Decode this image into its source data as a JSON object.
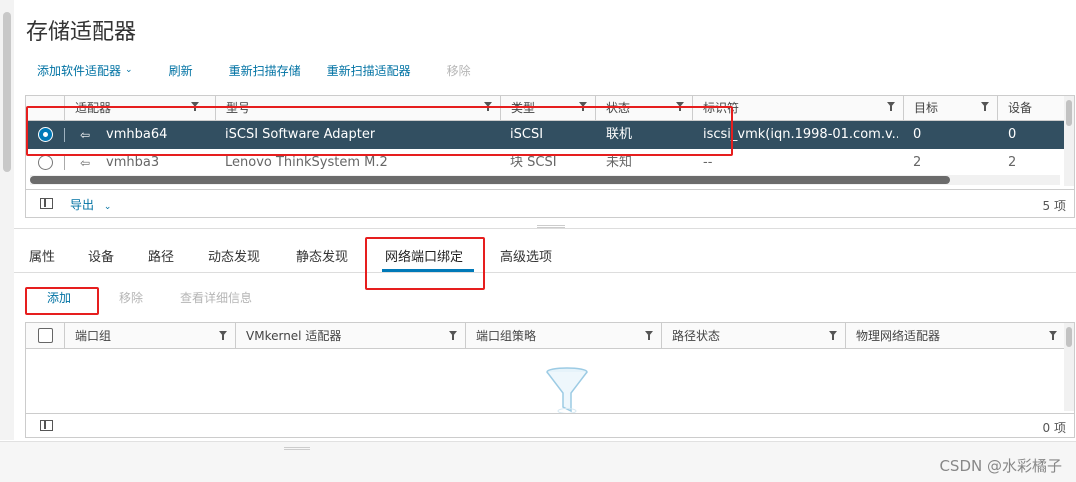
{
  "page": {
    "title": "存储适配器"
  },
  "toolbar": {
    "add_software_adapter": "添加软件适配器",
    "refresh": "刷新",
    "rescan_storage": "重新扫描存储",
    "rescan_adapter": "重新扫描适配器",
    "remove": "移除"
  },
  "adapters_grid": {
    "columns": [
      "适配器",
      "型号",
      "类型",
      "状态",
      "标识符",
      "目标",
      "设备"
    ],
    "rows": [
      {
        "selected": true,
        "adapter": "vmhba64",
        "model": "iSCSI Software Adapter",
        "type": "iSCSI",
        "status": "联机",
        "identifier": "iscsi_vmk(iqn.1998-01.com.v...",
        "targets": "0",
        "devices": "0"
      },
      {
        "selected": false,
        "adapter": "vmhba3",
        "model": "Lenovo ThinkSystem M.2",
        "type": "块 SCSI",
        "status": "未知",
        "identifier": "--",
        "targets": "2",
        "devices": "2"
      }
    ],
    "footer": {
      "export": "导出",
      "count": "5 项"
    }
  },
  "tabs": [
    "属性",
    "设备",
    "路径",
    "动态发现",
    "静态发现",
    "网络端口绑定",
    "高级选项"
  ],
  "active_tab": "网络端口绑定",
  "binding_actions": {
    "add": "添加",
    "remove": "移除",
    "view_details": "查看详细信息"
  },
  "binding_grid": {
    "columns": [
      "端口组",
      "VMkernel 适配器",
      "端口组策略",
      "路径状态",
      "物理网络适配器"
    ],
    "footer": {
      "count": "0 项"
    }
  },
  "watermark": "CSDN @水彩橘子",
  "colors": {
    "accent": "#0079b8",
    "link": "#0072a3",
    "selected_row": "#324f61",
    "annotation": "#e61e1e"
  }
}
